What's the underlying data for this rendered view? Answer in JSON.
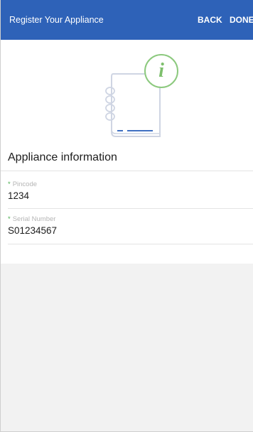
{
  "header": {
    "title": "Register Your Appliance",
    "back_label": "BACK",
    "done_label": "DONE",
    "background_color": "#2e62b8"
  },
  "illustration": {
    "badge_icon": "info-icon",
    "badge_glyph": "i",
    "badge_color": "#8cc97e",
    "book_icon": "manual-book-icon"
  },
  "form": {
    "section_title": "Appliance information",
    "required_marker": "*",
    "fields": [
      {
        "label": "Pincode",
        "value": "1234"
      },
      {
        "label": "Serial Number",
        "value": "S01234567"
      }
    ]
  }
}
